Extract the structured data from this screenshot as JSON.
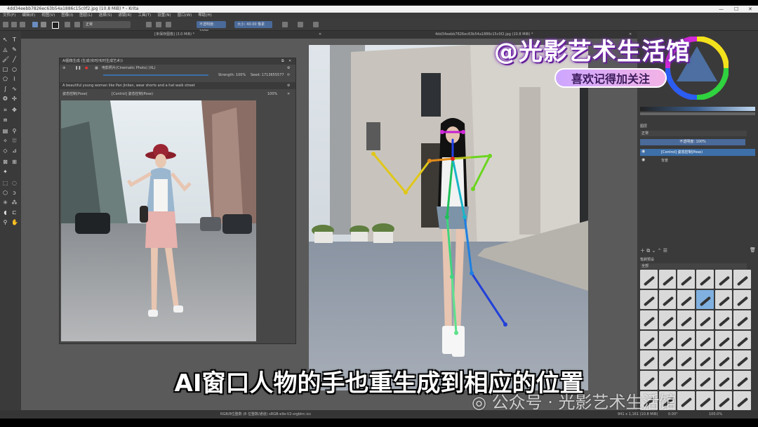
{
  "window": {
    "title": "4dd34eebb7826ec63b54a1886c15c0f2.jpg (10.8 MiB) * - Krita"
  },
  "menu": {
    "items": [
      "文件(F)",
      "编辑(E)",
      "视图(V)",
      "图像(I)",
      "图层(L)",
      "选择(S)",
      "滤镜(R)",
      "工具(T)",
      "设置(N)",
      "窗口(W)",
      "帮助(H)"
    ]
  },
  "toolbar": {
    "blend_mode": "正常",
    "opacity_label": "不透明度: 100%",
    "size_label": "大小: 40.00 像素"
  },
  "tabs": {
    "ai_doc": "[未保存图像] (3.0 MiB) *",
    "main_doc": "4dd34eebb7826ec63b54a1886c15c0f2.jpg (10.8 MiB) *"
  },
  "ai_docker": {
    "title": "AI图像生成 (生成(实时/实时生成艺术))",
    "style": "电影照片(Cinematic Photo) (XL)",
    "strength": "Strength: 100%",
    "seed": "Seed: 1713655577",
    "prompt": "A beautiful young woman like Pan Jinlian, wear shorts and a hat walk street",
    "control1": "姿态控制(Pose)",
    "control2": "[Control] 姿态控制(Pose)",
    "control_strength": "100%"
  },
  "right_dock": {
    "layers_title": "图层",
    "blend": "正常",
    "opacity": "不透明度: 100%",
    "layer1": "[Control] 姿态控制(Pose)",
    "layer2": "背景",
    "presets_title": "笔刷预设",
    "presets_filter": "全部"
  },
  "status": {
    "color_model": "RGB/8位整数 (8 位整数/通道) sRGB-elle-V2-srgbtrc.icc",
    "dims": "941 x 1,161 (10.8 MiB)",
    "rotation": "0.00°",
    "zoom": "100.0%"
  },
  "overlay": {
    "channel_title": "@光影艺术生活馆",
    "follow_text": "喜欢记得加关注",
    "subtitle": "AI窗口人物的手也重生成到相应的位置",
    "wechat": "公众号 · 光影艺术生活馆"
  },
  "colors": {
    "accent": "#3d6fa8",
    "overlay_purple": "#7a2fb5"
  }
}
